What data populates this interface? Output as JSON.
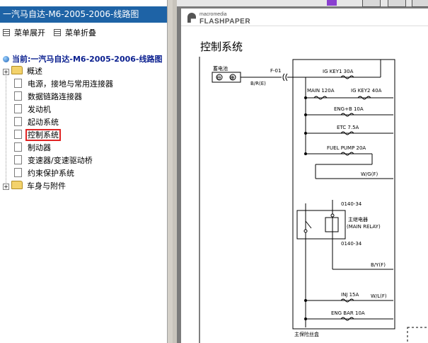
{
  "nav": {
    "title": "一汽马自达-M6-2005-2006-线路图",
    "expand_label": "菜单展开",
    "collapse_label": "菜单折叠",
    "current_label": "当前:一汽马自达-M6-2005-2006-线路图",
    "items": [
      {
        "label": "概述",
        "kind": "folder"
      },
      {
        "label": "电源，接地与常用连接器",
        "kind": "page"
      },
      {
        "label": "数据链路连接器",
        "kind": "page"
      },
      {
        "label": "发动机",
        "kind": "page"
      },
      {
        "label": "起动系统",
        "kind": "page"
      },
      {
        "label": "控制系统",
        "kind": "page",
        "selected": true
      },
      {
        "label": "制动器",
        "kind": "page"
      },
      {
        "label": "变速器/变速驱动桥",
        "kind": "page"
      },
      {
        "label": "约束保护系统",
        "kind": "page"
      },
      {
        "label": "车身与附件",
        "kind": "folder"
      }
    ]
  },
  "viewer": {
    "logo_top": "macromedia",
    "logo_bottom": "FLASHPAPER",
    "section_title": "控制系统",
    "selected_color": "#e02424",
    "title_bar_color": "#1e63a6"
  },
  "schematic": {
    "battery_label": "蓄电池",
    "battery_minus": "⊖",
    "battery_plus": "⊕",
    "wire_br": "B/R(E)",
    "connector": "F-01",
    "fuses": [
      {
        "label": "IG KEY1 30A"
      },
      {
        "label": "MAIN 120A"
      },
      {
        "label": "IG KEY2 40A"
      },
      {
        "label": "ENG+B 10A"
      },
      {
        "label": "ETC 7.5A"
      },
      {
        "label": "FUEL PUMP 20A"
      },
      {
        "label": "INJ 15A"
      },
      {
        "label": "ENG BAR 10A"
      }
    ],
    "wire_wg": "W/G(F)",
    "conn_top": "0140-34",
    "relay_cn": "主继电器",
    "relay_en": "(MAIN RELAY)",
    "conn_bottom": "0140-34",
    "wire_by": "B/Y(F)",
    "wire_wl": "W/L(F)",
    "fuse_box": "主保险丝盒"
  }
}
